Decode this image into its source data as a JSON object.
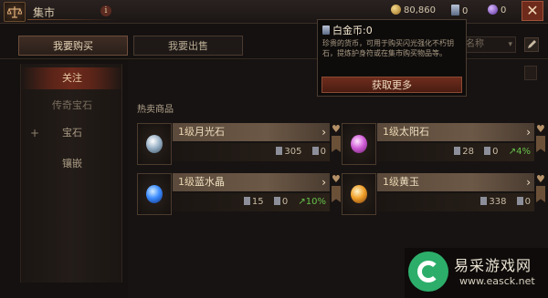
{
  "header": {
    "title": "集市",
    "info": "i",
    "currencies": [
      {
        "icon": "gold-coin-icon",
        "value": "80,860"
      },
      {
        "icon": "platinum-icon",
        "value": "0"
      },
      {
        "icon": "orb-icon",
        "value": "0"
      }
    ],
    "close": "✕"
  },
  "tabs": [
    {
      "label": "我要购买",
      "active": true
    },
    {
      "label": "我要出售",
      "active": false
    }
  ],
  "search": {
    "placeholder": "名称"
  },
  "sidebar": {
    "items": [
      {
        "label": "关注",
        "active": true
      },
      {
        "label": "传奇宝石",
        "active": false
      },
      {
        "label": "宝石",
        "active": false
      },
      {
        "label": "镶嵌",
        "active": false
      }
    ]
  },
  "main": {
    "hot_label": "热卖商品",
    "cards": [
      {
        "grade": "1级",
        "name": "月光石",
        "gem": "moonlight",
        "stock": "305",
        "sold": "0",
        "change": ""
      },
      {
        "grade": "1级",
        "name": "太阳石",
        "gem": "sunset",
        "stock": "28",
        "sold": "0",
        "change": "4%"
      },
      {
        "grade": "1级",
        "name": "蓝水晶",
        "gem": "sapphire",
        "stock": "15",
        "sold": "0",
        "change": "10%"
      },
      {
        "grade": "1级",
        "name": "黄玉",
        "gem": "jade",
        "stock": "338",
        "sold": "0",
        "change": ""
      }
    ]
  },
  "tooltip": {
    "title": "白金币:0",
    "desc": "珍贵的货币，可用于购买闪光强化不朽钥石，提炼护身符或在集市购买物品等。",
    "button": "获取更多"
  },
  "watermark": {
    "name": "易采游戏网",
    "url": "www.easck.net"
  },
  "colors": {
    "accent_red": "#6e2a1b",
    "up_green": "#67c24b",
    "gold": "#f5d98a"
  }
}
